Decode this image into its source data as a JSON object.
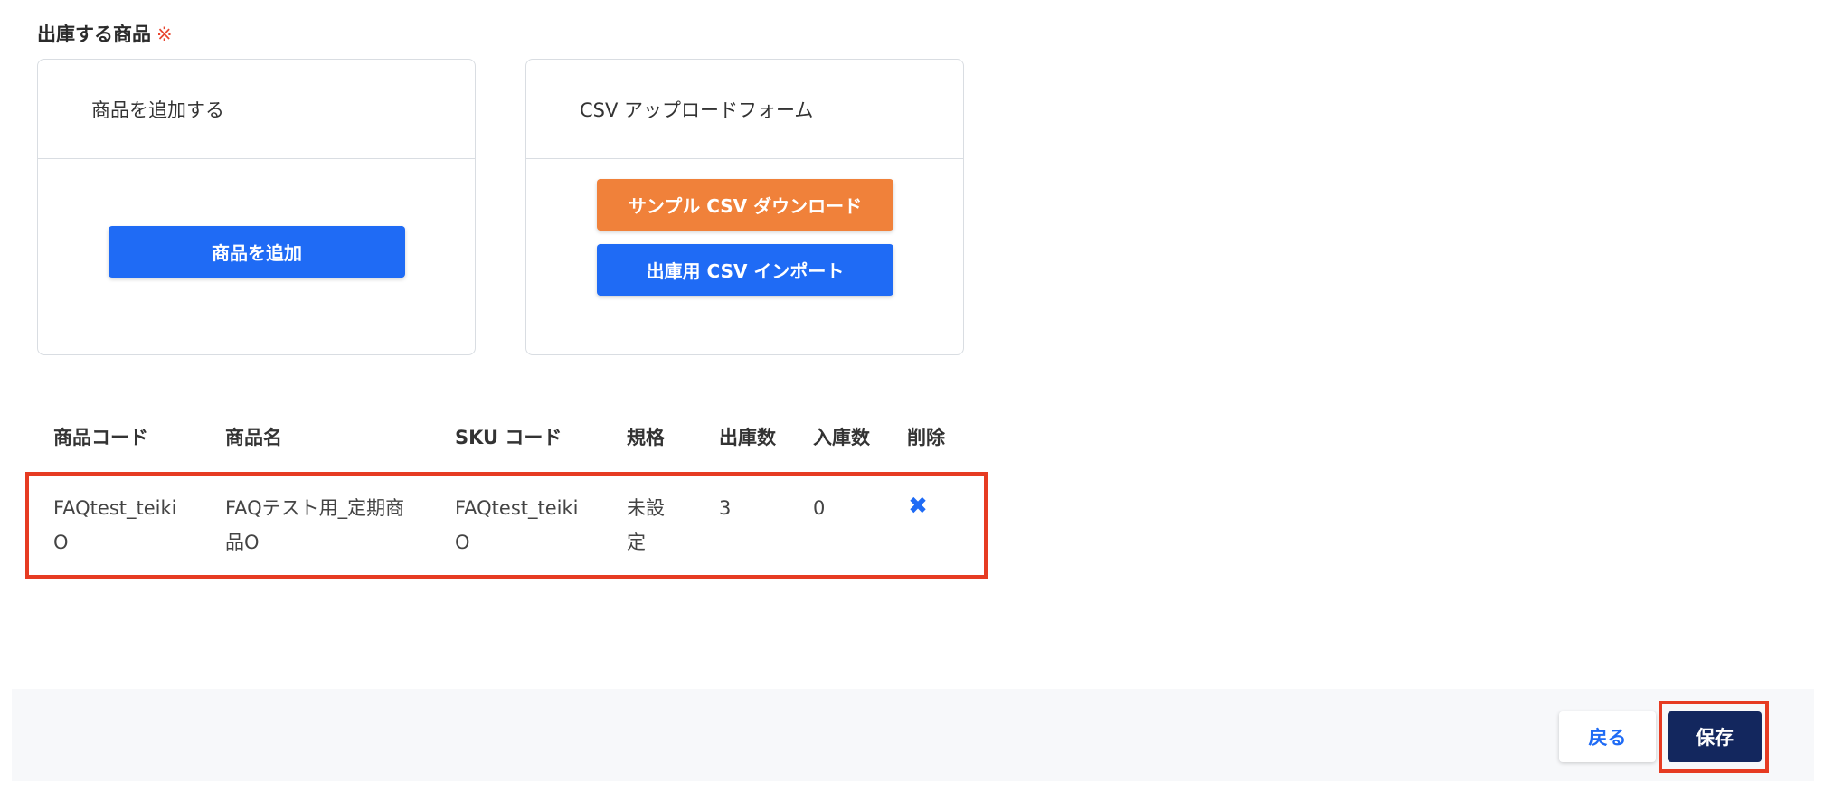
{
  "section": {
    "title": "出庫する商品",
    "required_mark": "※"
  },
  "add_card": {
    "header": "商品を追加する",
    "add_button": "商品を追加"
  },
  "csv_card": {
    "header": "CSV アップロードフォーム",
    "sample_button": "サンプル CSV ダウンロード",
    "import_button": "出庫用 CSV インポート"
  },
  "table": {
    "headers": [
      "商品コード",
      "商品名",
      "SKU コード",
      "規格",
      "出庫数",
      "入庫数",
      "削除"
    ],
    "rows": [
      {
        "code_line1": "FAQtest_teiki",
        "code_line2": "O",
        "name_line1": "FAQテスト用_定期商",
        "name_line2": "品O",
        "sku_line1": "FAQtest_teiki",
        "sku_line2": "O",
        "spec_line1": "未設",
        "spec_line2": "定",
        "out_qty": "3",
        "in_qty": "0",
        "delete_icon": "✖"
      }
    ]
  },
  "footer": {
    "back_label": "戻る",
    "save_label": "保存"
  }
}
